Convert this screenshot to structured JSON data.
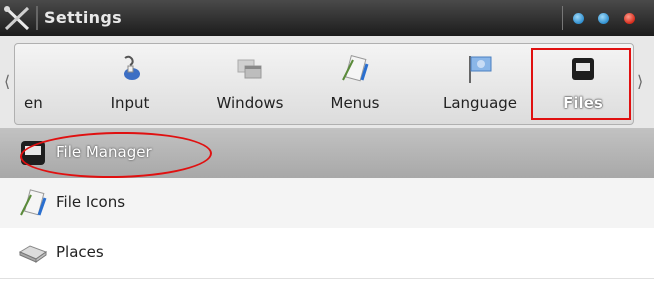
{
  "window": {
    "title": "Settings",
    "app_icon": "tools-icon",
    "controls": {
      "minimize": "minimize-button",
      "maximize": "maximize-button",
      "close": "close-button"
    }
  },
  "toolbar": {
    "scroll_left": "⟨",
    "scroll_right": "⟩",
    "items": [
      {
        "label": "en",
        "icon": "screen-icon"
      },
      {
        "label": "Input",
        "icon": "keyboard-icon"
      },
      {
        "label": "Windows",
        "icon": "windows-icon"
      },
      {
        "label": "Menus",
        "icon": "menu-editor-icon"
      },
      {
        "label": "Language",
        "icon": "flag-icon"
      },
      {
        "label": "Files",
        "icon": "file-manager-icon",
        "selected": true
      }
    ]
  },
  "list": {
    "items": [
      {
        "label": "File Manager",
        "icon": "file-manager-icon",
        "selected": true
      },
      {
        "label": "File Icons",
        "icon": "file-icons-icon"
      },
      {
        "label": "Places",
        "icon": "drive-icon"
      }
    ]
  },
  "colors": {
    "annotation": "#e01010",
    "titlebar": "#2a2a2a",
    "window_button_blue": "#2f8fd0",
    "window_button_red": "#d62a1a"
  }
}
